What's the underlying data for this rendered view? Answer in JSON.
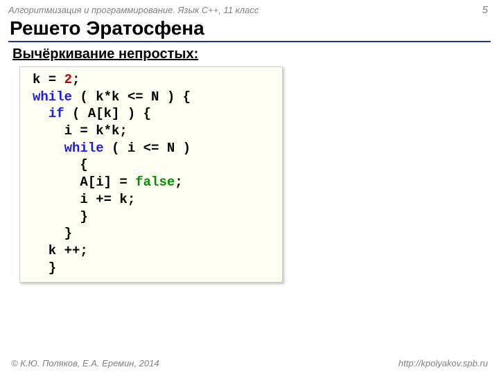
{
  "header": {
    "course": "Алгоритмизация и программирование. Язык C++, 11 класс",
    "page_number": "5"
  },
  "title": "Решето Эратосфена",
  "subtitle": "Вычёркивание непростых:",
  "code": {
    "l01a": "k = ",
    "l01b": "2",
    "l01c": ";",
    "kw_while": "while",
    "l02a": " ( k*k <= N ) {",
    "kw_if": "if",
    "l03a": " ( A[k] ) {",
    "l04": "    i = k*k;",
    "l05a": " ( i <= N )",
    "l06": "      {",
    "l07a": "      A[i] = ",
    "l07b": "false",
    "l07c": ";",
    "l08": "      i += k;",
    "l09": "      }",
    "l10": "    }",
    "l11": "  k ++;",
    "l12": "  }"
  },
  "footer": {
    "copyright": "© К.Ю. Поляков, Е.А. Еремин, 2014",
    "url": "http://kpolyakov.spb.ru"
  }
}
